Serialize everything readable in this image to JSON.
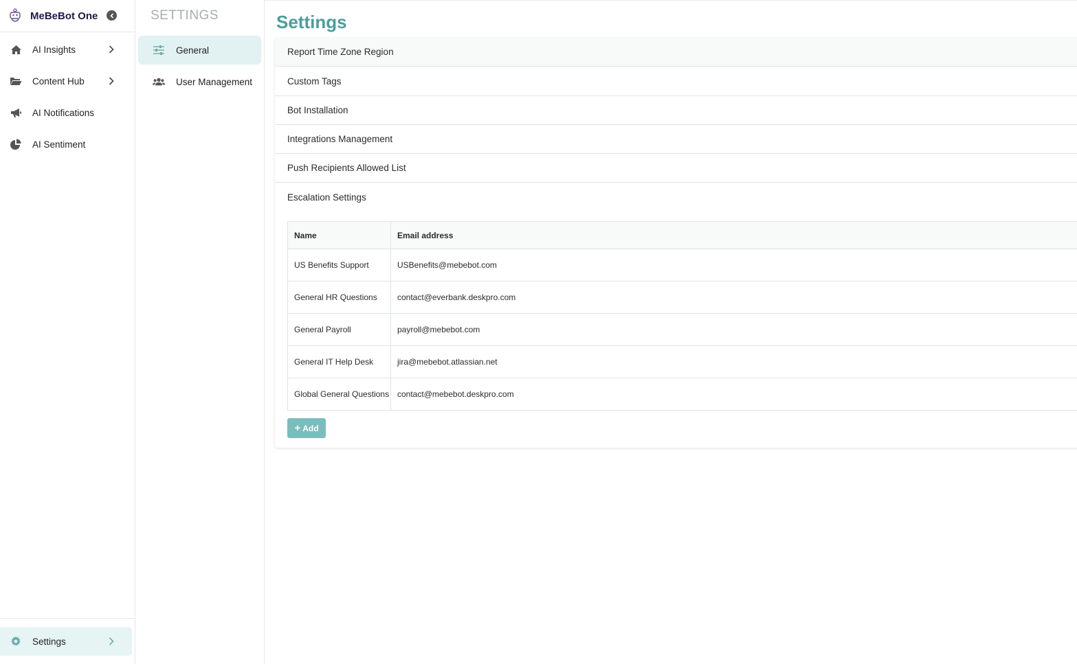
{
  "brand": {
    "name": "MeBeBot One"
  },
  "nav": {
    "items": [
      {
        "label": "AI Insights",
        "icon": "home-icon",
        "has_submenu": true
      },
      {
        "label": "Content Hub",
        "icon": "folder-icon",
        "has_submenu": true
      },
      {
        "label": "AI Notifications",
        "icon": "megaphone-icon",
        "has_submenu": false
      },
      {
        "label": "AI Sentiment",
        "icon": "pie-chart-icon",
        "has_submenu": false
      }
    ],
    "settings": {
      "label": "Settings",
      "icon": "gear-icon",
      "active": true
    }
  },
  "subnav": {
    "title": "SETTINGS",
    "items": [
      {
        "label": "General",
        "icon": "sliders-icon",
        "active": true
      },
      {
        "label": "User Management",
        "icon": "users-icon",
        "active": false
      }
    ]
  },
  "main": {
    "title": "Settings",
    "sections": [
      {
        "label": "Report Time Zone Region"
      },
      {
        "label": "Custom Tags"
      },
      {
        "label": "Bot Installation"
      },
      {
        "label": "Integrations Management"
      },
      {
        "label": "Push Recipients Allowed List"
      },
      {
        "label": "Escalation Settings",
        "expanded": true
      }
    ],
    "escalation_table": {
      "columns": [
        "Name",
        "Email address"
      ],
      "rows": [
        {
          "name": "US Benefits Support",
          "email": "USBenefits@mebebot.com"
        },
        {
          "name": "General HR Questions",
          "email": "contact@everbank.deskpro.com"
        },
        {
          "name": "General Payroll",
          "email": "payroll@mebebot.com"
        },
        {
          "name": "General IT Help Desk",
          "email": "jira@mebebot.atlassian.net"
        },
        {
          "name": "Global General Questions",
          "email": "contact@mebebot.deskpro.com"
        }
      ]
    },
    "add_button": {
      "label": "Add"
    }
  },
  "colors": {
    "accent": "#4a9e9e",
    "active_bg": "#e2f1f1",
    "button": "#7bbdbd",
    "brand_text": "#1e1a4d"
  }
}
